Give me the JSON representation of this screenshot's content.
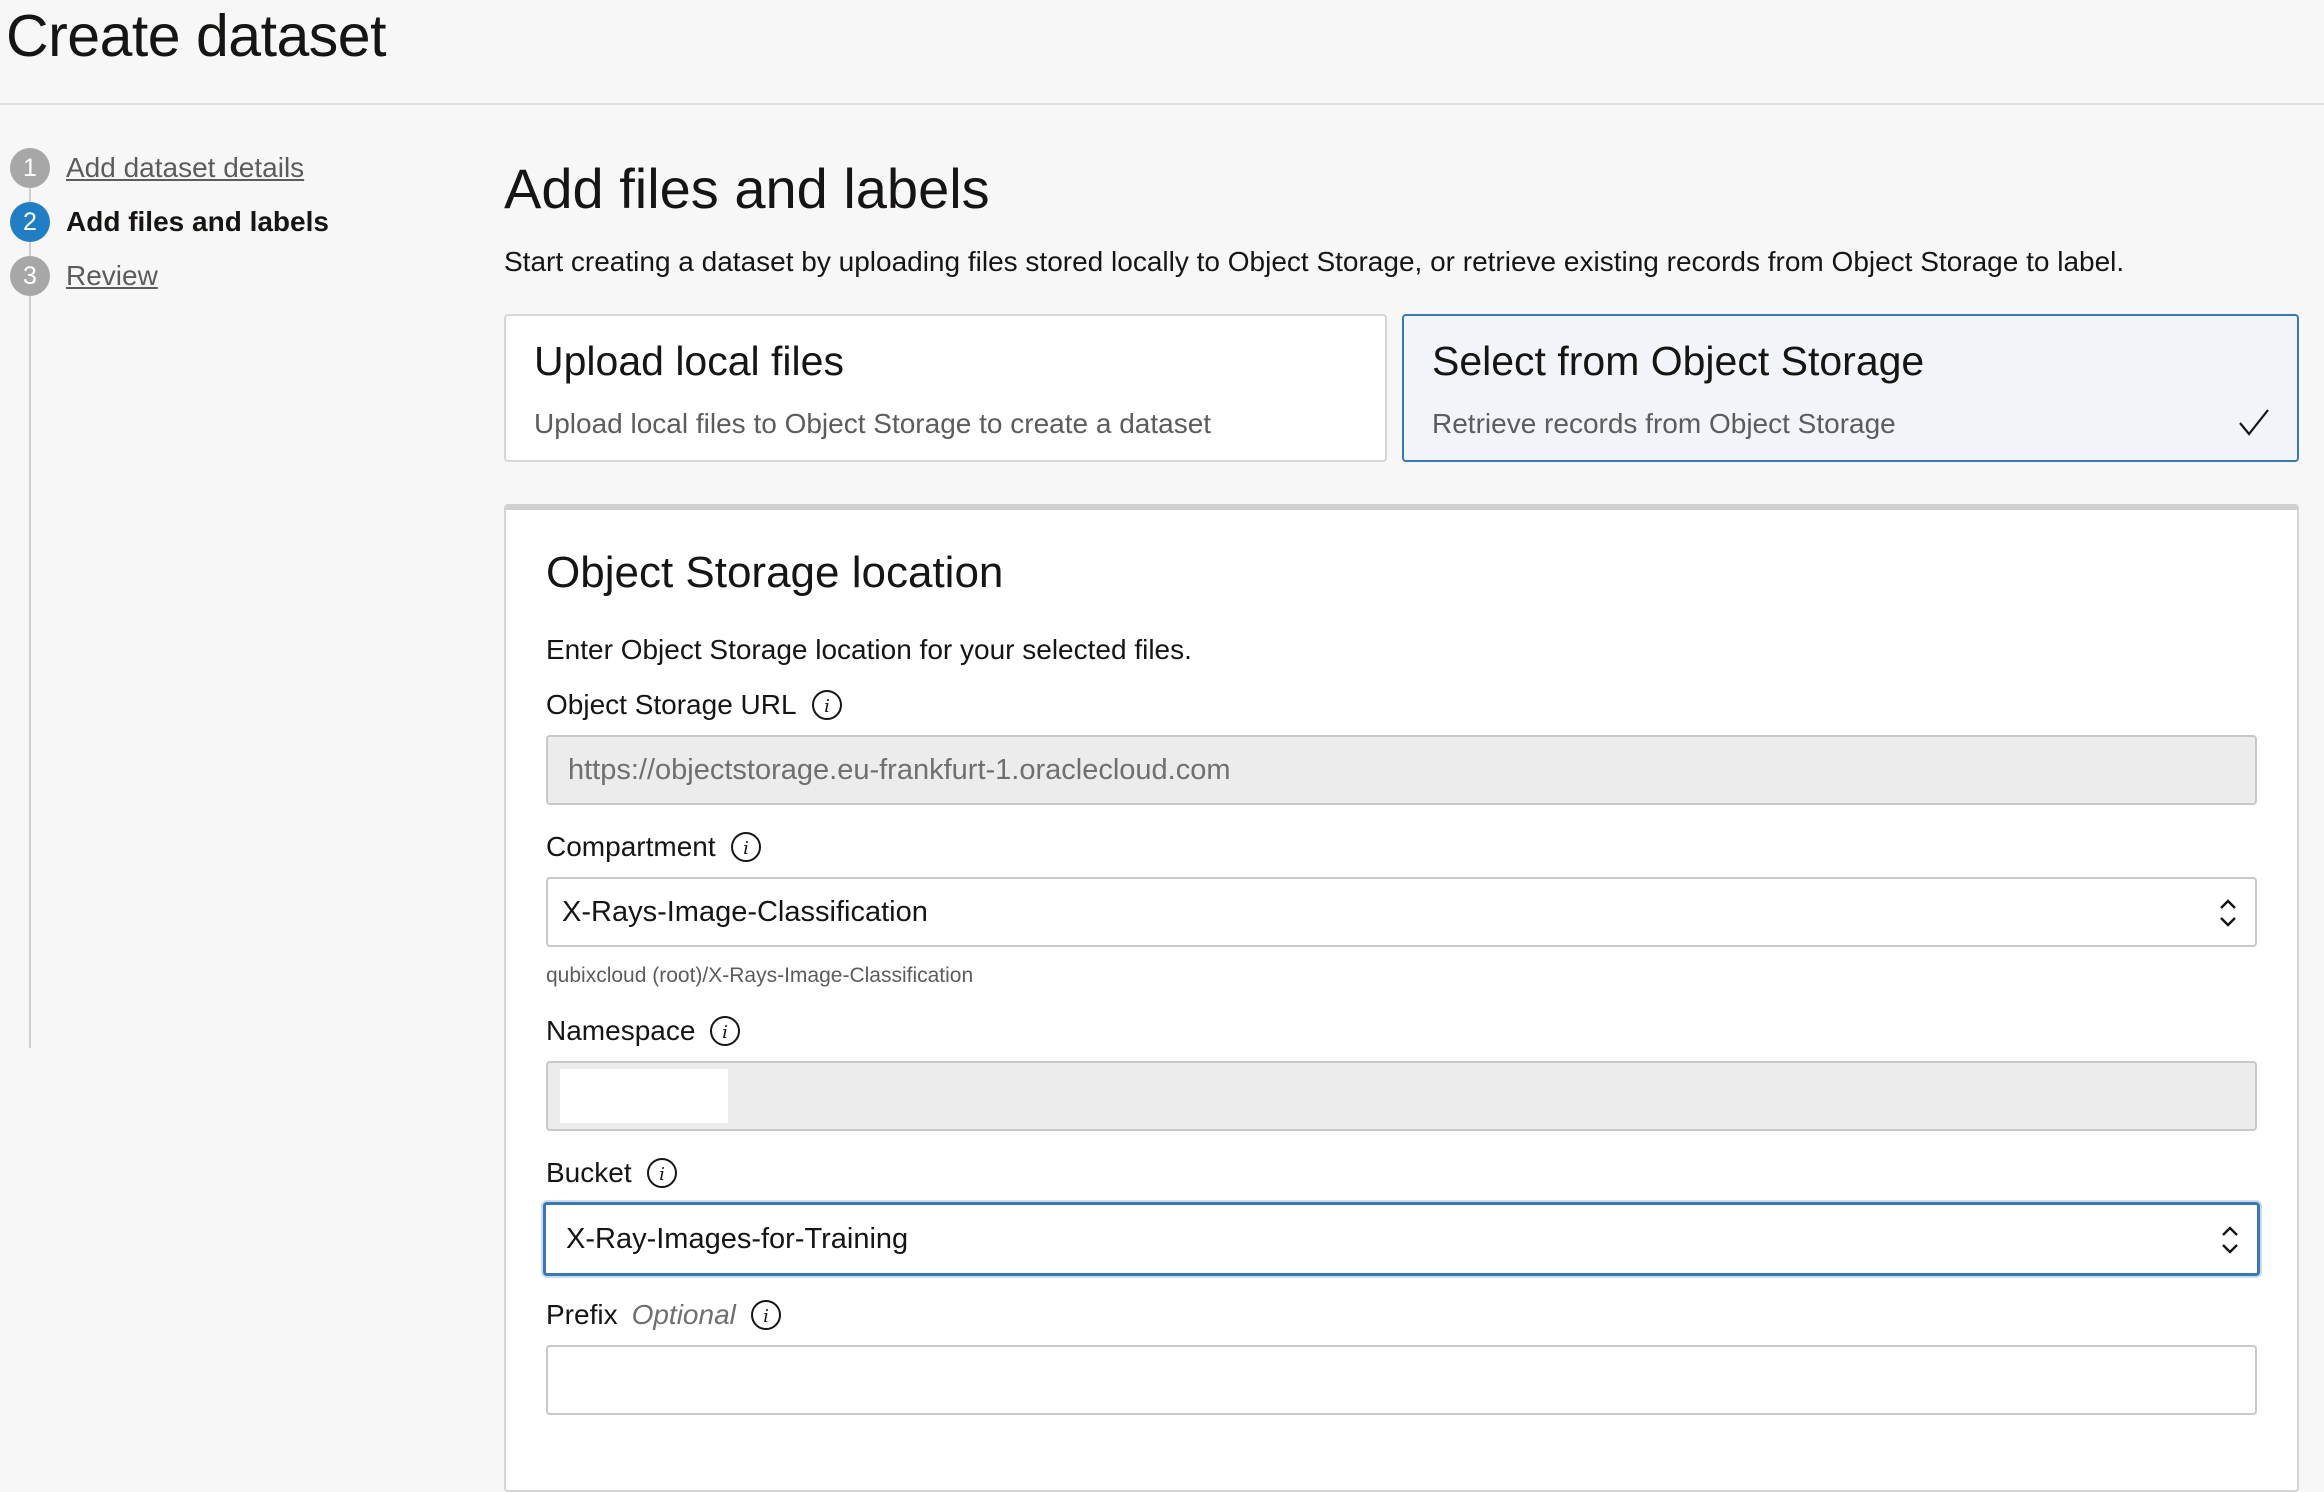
{
  "page": {
    "title": "Create dataset"
  },
  "steps": [
    {
      "number": "1",
      "label": "Add dataset details",
      "state": "completed"
    },
    {
      "number": "2",
      "label": "Add files and labels",
      "state": "active"
    },
    {
      "number": "3",
      "label": "Review",
      "state": "pending"
    }
  ],
  "main": {
    "title": "Add files and labels",
    "description": "Start creating a dataset by uploading files stored locally to Object Storage, or retrieve existing records from Object Storage to label."
  },
  "options": {
    "upload": {
      "title": "Upload local files",
      "description": "Upload local files to Object Storage to create a dataset",
      "selected": false
    },
    "select": {
      "title": "Select from Object Storage",
      "description": "Retrieve records from Object Storage",
      "selected": true
    }
  },
  "panel": {
    "title": "Object Storage location",
    "description": "Enter Object Storage location for your selected files.",
    "fields": {
      "url": {
        "label": "Object Storage URL",
        "value": "https://objectstorage.eu-frankfurt-1.oraclecloud.com",
        "readonly": true
      },
      "compartment": {
        "label": "Compartment",
        "value": "X-Rays-Image-Classification",
        "helper": "qubixcloud (root)/X-Rays-Image-Classification"
      },
      "namespace": {
        "label": "Namespace",
        "value": "",
        "readonly": true
      },
      "bucket": {
        "label": "Bucket",
        "value": "X-Ray-Images-for-Training"
      },
      "prefix": {
        "label": "Prefix",
        "optional_label": "Optional",
        "value": ""
      }
    }
  },
  "colors": {
    "accent": "#227ec4",
    "selected_border": "#3a78b3",
    "selected_bg": "#f1f5fa",
    "step_inactive": "#a7a7a7"
  },
  "icons": {
    "info": "info-icon",
    "check": "check-icon",
    "select_chevron": "chevron-updown-icon"
  }
}
